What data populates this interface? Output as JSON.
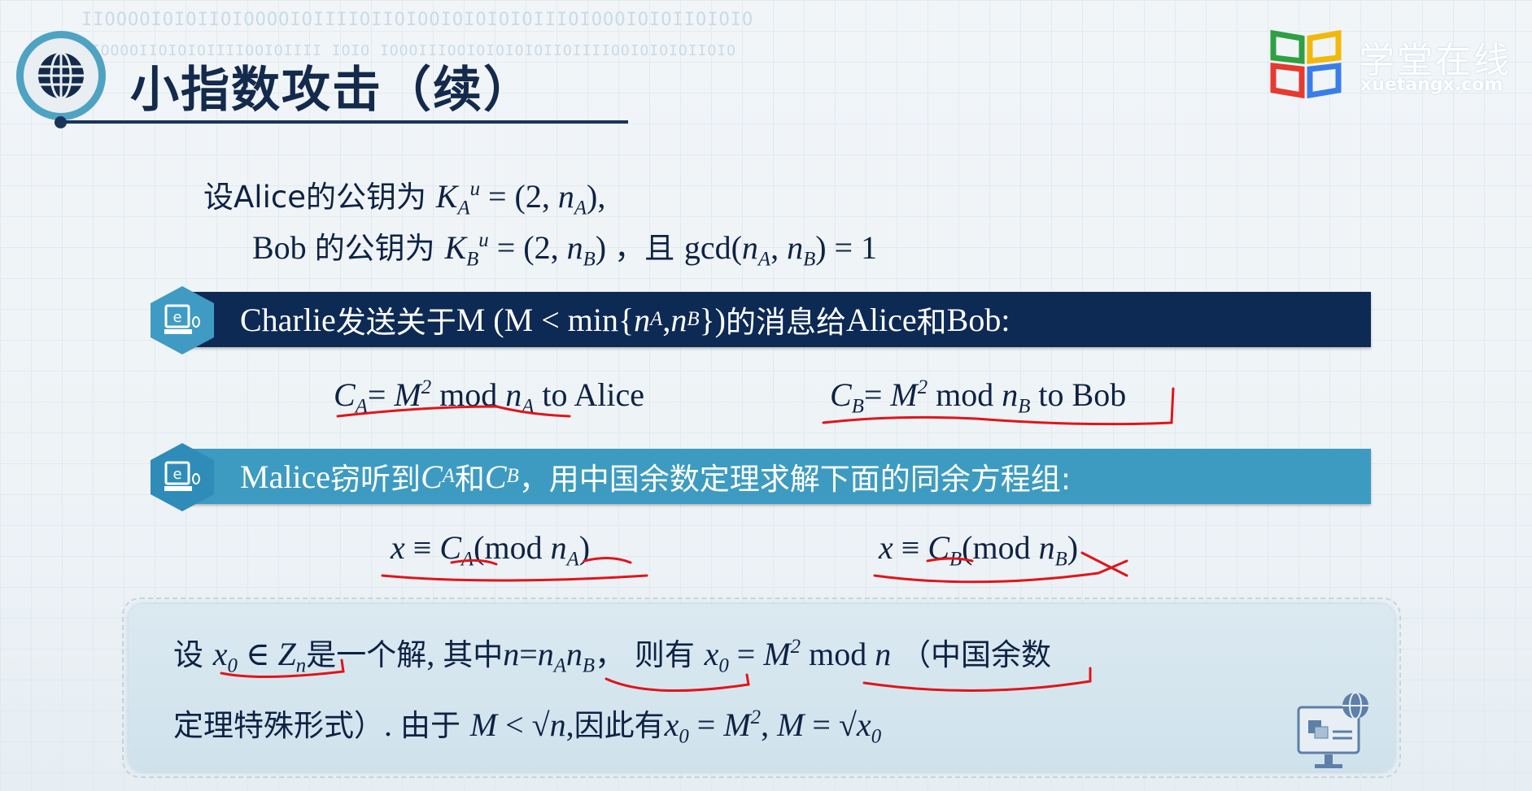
{
  "decor": {
    "binary1": "IIOOOOIOIOIIOIOOOOIOIIIIOIIOIOOIOIOIOIOIIIOIOOOIOIOIIOIOIO",
    "binary2": "IIOOOOIIOIOIOIIIIOOIOIIII IOIO IOOOIIIOOIOIOIOIOIIOIIIIOOIOIOIOIIOIO"
  },
  "title": "小指数攻击（续）",
  "logo": {
    "name": "学堂在线",
    "domain": "xuetangx.com",
    "colors": [
      "#2ea043",
      "#f2b90c",
      "#e53a2f",
      "#3b7de8"
    ]
  },
  "colors": {
    "navy": "#0d2a55",
    "teal": "#3d9bc1",
    "ink": "#e0151a"
  },
  "lines": {
    "keyA": [
      {
        "t": "设Alice的公钥为 ",
        "s": "cn"
      },
      {
        "t": "K",
        "s": "i"
      },
      {
        "t": "A",
        "s": "sub"
      },
      {
        "t": "u",
        "s": "sup"
      },
      {
        "t": " = (2, ",
        "s": ""
      },
      {
        "t": "n",
        "s": "i"
      },
      {
        "t": "A",
        "s": "sub"
      },
      {
        "t": "),",
        "s": ""
      }
    ],
    "keyB": [
      {
        "t": "Bob ",
        "s": ""
      },
      {
        "t": "的公钥为 ",
        "s": "cn"
      },
      {
        "t": "K",
        "s": "i"
      },
      {
        "t": "B",
        "s": "sub"
      },
      {
        "t": "u",
        "s": "sup"
      },
      {
        "t": " = (2, ",
        "s": ""
      },
      {
        "t": "n",
        "s": "i"
      },
      {
        "t": "B",
        "s": "sub"
      },
      {
        "t": ") ",
        "s": ""
      },
      {
        "t": "，且 ",
        "s": "cn"
      },
      {
        "t": "gcd(",
        "s": ""
      },
      {
        "t": "n",
        "s": "i"
      },
      {
        "t": "A",
        "s": "sub"
      },
      {
        "t": ", ",
        "s": ""
      },
      {
        "t": "n",
        "s": "i"
      },
      {
        "t": "B",
        "s": "sub"
      },
      {
        "t": ") = 1",
        "s": ""
      }
    ],
    "banner1": [
      {
        "t": "Charlie ",
        "s": ""
      },
      {
        "t": "发送关于",
        "s": "cn"
      },
      {
        "t": "M (M < min{",
        "s": ""
      },
      {
        "t": "n",
        "s": "i"
      },
      {
        "t": "A",
        "s": "sub"
      },
      {
        "t": ", ",
        "s": ""
      },
      {
        "t": "n",
        "s": "i"
      },
      {
        "t": "B",
        "s": "sub"
      },
      {
        "t": "})",
        "s": ""
      },
      {
        "t": "的消息给",
        "s": "cn"
      },
      {
        "t": "Alice",
        "s": ""
      },
      {
        "t": "和",
        "s": "cn"
      },
      {
        "t": "Bob:",
        "s": ""
      }
    ],
    "cA": [
      {
        "t": "C",
        "s": "i"
      },
      {
        "t": "A",
        "s": "sub"
      },
      {
        "t": "= ",
        "s": ""
      },
      {
        "t": "M",
        "s": "i"
      },
      {
        "t": "2",
        "s": "sup"
      },
      {
        "t": " mod ",
        "s": ""
      },
      {
        "t": "n",
        "s": "i"
      },
      {
        "t": "A",
        "s": "sub"
      },
      {
        "t": " to Alice",
        "s": ""
      }
    ],
    "cB": [
      {
        "t": "C",
        "s": "i"
      },
      {
        "t": "B",
        "s": "sub"
      },
      {
        "t": "= ",
        "s": ""
      },
      {
        "t": "M",
        "s": "i"
      },
      {
        "t": "2",
        "s": "sup"
      },
      {
        "t": " mod ",
        "s": ""
      },
      {
        "t": "n",
        "s": "i"
      },
      {
        "t": "B",
        "s": "sub"
      },
      {
        "t": " to Bob",
        "s": ""
      }
    ],
    "banner2": [
      {
        "t": "Malice ",
        "s": ""
      },
      {
        "t": "窃听到",
        "s": "cn"
      },
      {
        "t": "C",
        "s": "i"
      },
      {
        "t": "A",
        "s": "sub"
      },
      {
        "t": " 和 ",
        "s": "cn"
      },
      {
        "t": "C",
        "s": "i"
      },
      {
        "t": "B",
        "s": "sub"
      },
      {
        "t": "，用中国余数定理求解下面的同余方程组:",
        "s": "cn"
      }
    ],
    "congA": [
      {
        "t": "x",
        "s": "i"
      },
      {
        "t": " ≡ ",
        "s": ""
      },
      {
        "t": "C",
        "s": "i"
      },
      {
        "t": "A",
        "s": "sub"
      },
      {
        "t": "(mod ",
        "s": ""
      },
      {
        "t": "n",
        "s": "i"
      },
      {
        "t": "A",
        "s": "sub"
      },
      {
        "t": ")",
        "s": ""
      }
    ],
    "congB": [
      {
        "t": "x",
        "s": "i"
      },
      {
        "t": " ≡ ",
        "s": ""
      },
      {
        "t": "C",
        "s": "i"
      },
      {
        "t": "B",
        "s": "sub"
      },
      {
        "t": "(mod ",
        "s": ""
      },
      {
        "t": "n",
        "s": "i"
      },
      {
        "t": "B",
        "s": "sub"
      },
      {
        "t": ")",
        "s": ""
      }
    ],
    "box1": [
      {
        "t": "设 ",
        "s": "cn"
      },
      {
        "t": "x",
        "s": "i"
      },
      {
        "t": "0",
        "s": "sub"
      },
      {
        "t": " ∈ ",
        "s": ""
      },
      {
        "t": "Z",
        "s": "i"
      },
      {
        "t": "n",
        "s": "sub"
      },
      {
        "t": "是一个解",
        "s": "cn"
      },
      {
        "t": ", ",
        "s": ""
      },
      {
        "t": "其中",
        "s": "cn"
      },
      {
        "t": "n",
        "s": "i"
      },
      {
        "t": "=",
        "s": ""
      },
      {
        "t": "n",
        "s": "i"
      },
      {
        "t": "A",
        "s": "sub"
      },
      {
        "t": "n",
        "s": "i"
      },
      {
        "t": "B",
        "s": "sub"
      },
      {
        "t": "，  则有 ",
        "s": "cn"
      },
      {
        "t": "x",
        "s": "i"
      },
      {
        "t": "0",
        "s": "sub"
      },
      {
        "t": " = ",
        "s": ""
      },
      {
        "t": "M",
        "s": "i"
      },
      {
        "t": "2",
        "s": "sup"
      },
      {
        "t": " mod ",
        "s": ""
      },
      {
        "t": "n",
        "s": "i"
      },
      {
        "t": "  （中国余数",
        "s": "cn"
      }
    ],
    "box2": [
      {
        "t": "定理特殊形式）",
        "s": "cn"
      },
      {
        "t": ". ",
        "s": ""
      },
      {
        "t": "由于 ",
        "s": "cn"
      },
      {
        "t": "M",
        "s": "i"
      },
      {
        "t": " < √",
        "s": ""
      },
      {
        "t": "n",
        "s": "i"
      },
      {
        "t": ",",
        "s": ""
      },
      {
        "t": "因此有",
        "s": "cn"
      },
      {
        "t": "x",
        "s": "i"
      },
      {
        "t": "0",
        "s": "sub"
      },
      {
        "t": " = ",
        "s": ""
      },
      {
        "t": "M",
        "s": "i"
      },
      {
        "t": "2",
        "s": "sup"
      },
      {
        "t": ", ",
        "s": ""
      },
      {
        "t": "M",
        "s": "i"
      },
      {
        "t": " =     √",
        "s": ""
      },
      {
        "t": "x",
        "s": "i"
      },
      {
        "t": "0",
        "s": "sub"
      }
    ]
  }
}
